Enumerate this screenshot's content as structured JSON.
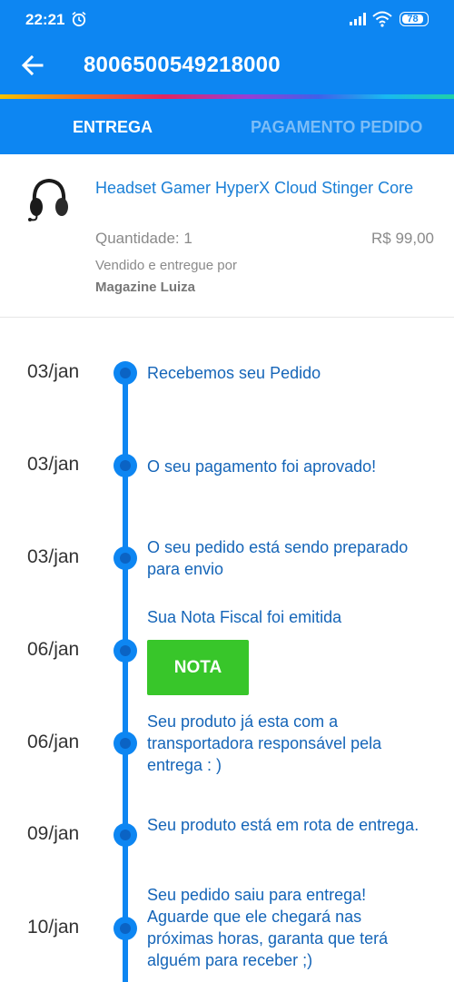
{
  "status_bar": {
    "time": "22:21",
    "battery": "78",
    "icons": [
      "alarm-icon",
      "signal-icon",
      "wifi-icon",
      "battery-icon"
    ]
  },
  "header": {
    "back_icon": "arrow-left-icon",
    "order_number": "8006500549218000"
  },
  "tabs": [
    {
      "label": "ENTREGA",
      "active": true
    },
    {
      "label": "PAGAMENTO PEDIDO",
      "active": false
    }
  ],
  "product": {
    "name": "Headset Gamer HyperX Cloud Stinger Core",
    "quantity": "Quantidade: 1",
    "price": "R$ 99,00",
    "seller_label": "Vendido e entregue por",
    "seller_name": "Magazine Luiza"
  },
  "timeline": [
    {
      "date": "03/jan",
      "text": "Recebemos seu Pedido"
    },
    {
      "date": "03/jan",
      "text": "O seu pagamento foi aprovado!"
    },
    {
      "date": "03/jan",
      "text": "O seu pedido está sendo preparado para envio"
    },
    {
      "date": "06/jan",
      "text": "Sua Nota Fiscal foi emitida",
      "button": "NOTA"
    },
    {
      "date": "06/jan",
      "text": "Seu produto já esta com a transportadora responsável pela entrega : )"
    },
    {
      "date": "09/jan",
      "text": "Seu produto está em rota de entrega."
    },
    {
      "date": "10/jan",
      "text": "Seu pedido saiu para entrega! Aguarde que ele chegará nas próximas horas, garanta que terá alguém para receber ;)"
    }
  ],
  "colors": {
    "primary": "#0d86f2",
    "link": "#1a7fd6",
    "timeline_text": "#1565b8",
    "nota_button": "#38c62a"
  }
}
